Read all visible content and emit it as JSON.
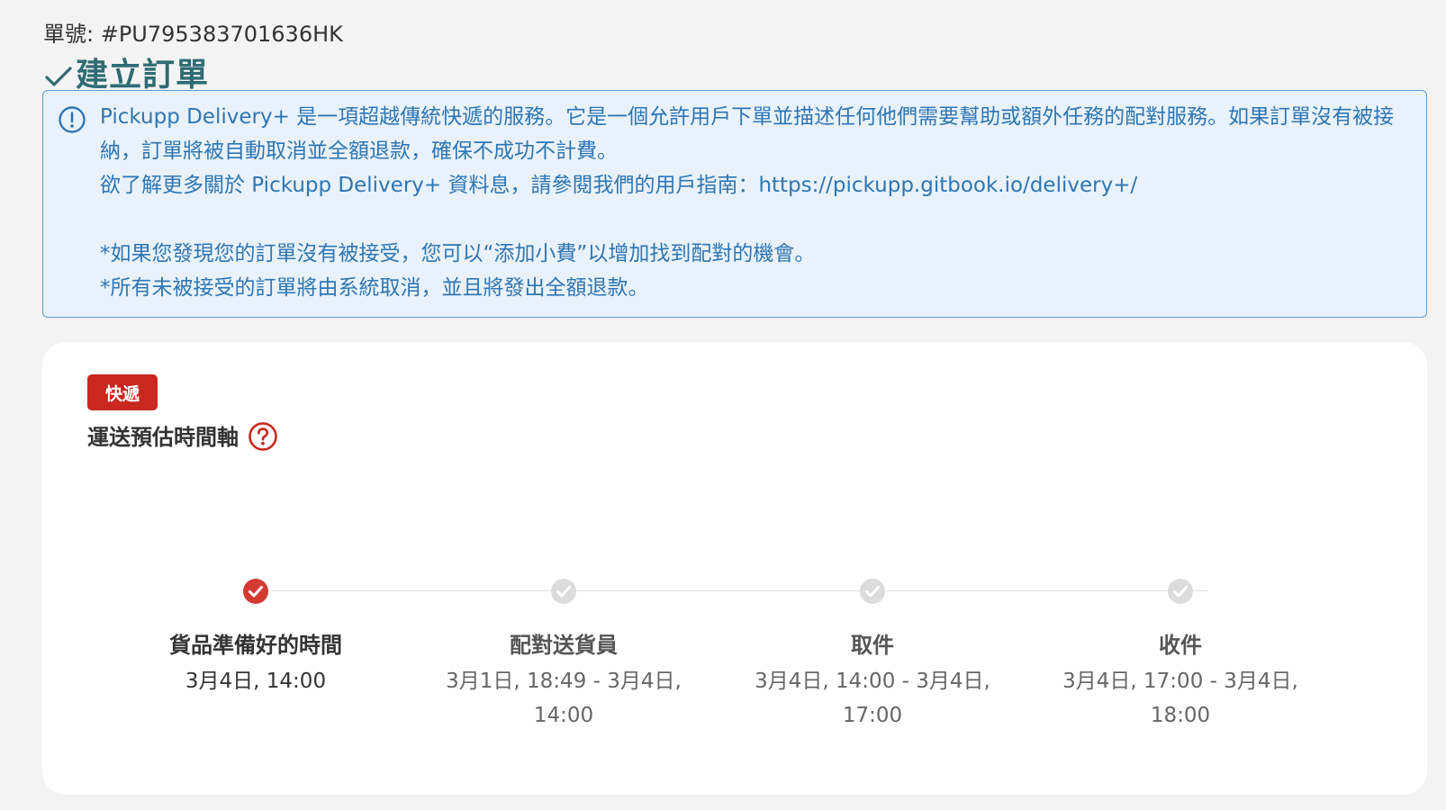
{
  "order": {
    "number_text": "單號: #PU795383701636HK"
  },
  "status": {
    "title": "建立訂單",
    "color": "#2f6b73"
  },
  "notice": {
    "line1": "Pickupp Delivery+ 是一項超越傳統快遞的服務。它是一個允許用戶下單並描述任何他們需要幫助或額外任務的配對服務。如果訂單沒有被接納，訂單將被自動取消並全額退款，確保不成功不計費。",
    "line2": "欲了解更多關於 Pickupp Delivery+ 資料息，請參閱我們的用戶指南：https://pickupp.gitbook.io/delivery+/",
    "line3": "*如果您發現您的訂單沒有被接受，您可以“添加小費”以增加找到配對的機會。",
    "line4": "*所有未被接受的訂單將由系統取消，並且將發出全額退款。",
    "icon": "info-circle-icon"
  },
  "delivery": {
    "tag": "快遞",
    "tag_color": "#c9271f",
    "section_title": "運送預估時間軸",
    "help_icon": "question-circle-icon",
    "steps": [
      {
        "label": "貨品準備好的時間",
        "time": "3月4日, 14:00",
        "completed": true
      },
      {
        "label": "配對送貨員",
        "time": "3月1日, 18:49 - 3月4日, 14:00",
        "completed": false
      },
      {
        "label": "取件",
        "time": "3月4日, 14:00 - 3月4日, 17:00",
        "completed": false
      },
      {
        "label": "收件",
        "time": "3月4日, 17:00 - 3月4日, 18:00",
        "completed": false
      }
    ]
  }
}
